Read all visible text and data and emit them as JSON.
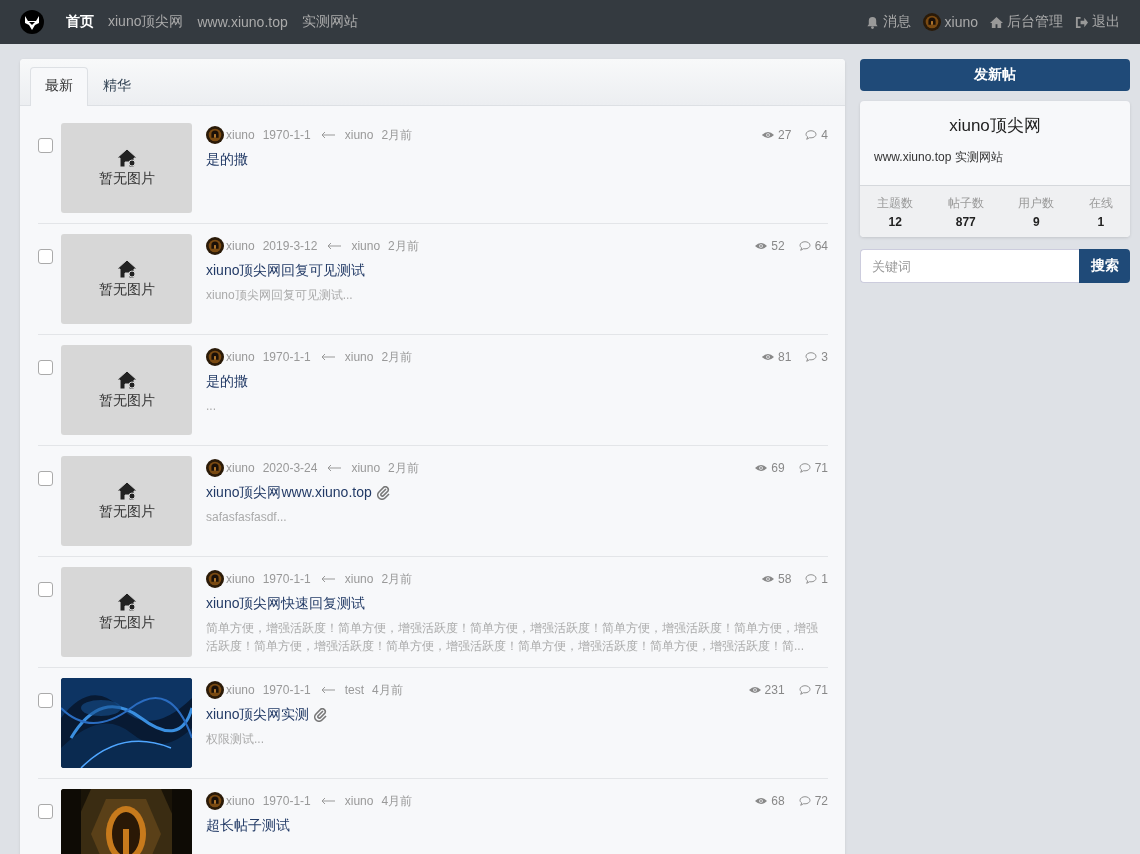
{
  "navbar": {
    "links": [
      {
        "label": "首页",
        "selected": true
      },
      {
        "label": "xiuno顶尖网",
        "selected": false
      },
      {
        "label": "www.xiuno.top",
        "selected": false
      },
      {
        "label": "实测网站",
        "selected": false
      }
    ],
    "right": [
      {
        "kind": "bell",
        "label": "消息"
      },
      {
        "kind": "avatar",
        "label": "xiuno"
      },
      {
        "kind": "home",
        "label": "后台管理"
      },
      {
        "kind": "logout",
        "label": "退出"
      }
    ]
  },
  "tabs": [
    {
      "label": "最新",
      "selected": true
    },
    {
      "label": "精华",
      "selected": false
    }
  ],
  "threads": [
    {
      "checked": false,
      "thumb": {
        "kind": "placeholder",
        "text": "暂无图片"
      },
      "author": "xiuno",
      "date": "1970-1-1",
      "last_user": "xiuno",
      "last_time": "2月前",
      "views": "27",
      "replies": "4",
      "title": "是的撒",
      "attachment": false
    },
    {
      "checked": false,
      "thumb": {
        "kind": "placeholder",
        "text": "暂无图片"
      },
      "author": "xiuno",
      "date": "2019-3-12",
      "last_user": "xiuno",
      "last_time": "2月前",
      "views": "52",
      "replies": "64",
      "title": "xiuno顶尖网回复可见测试",
      "excerpt": "xiuno顶尖网回复可见测试...",
      "attachment": false
    },
    {
      "checked": false,
      "thumb": {
        "kind": "placeholder",
        "text": "暂无图片"
      },
      "author": "xiuno",
      "date": "1970-1-1",
      "last_user": "xiuno",
      "last_time": "2月前",
      "views": "81",
      "replies": "3",
      "title": "是的撒",
      "excerpt": "...",
      "attachment": false
    },
    {
      "checked": false,
      "thumb": {
        "kind": "placeholder",
        "text": "暂无图片"
      },
      "author": "xiuno",
      "date": "2020-3-24",
      "last_user": "xiuno",
      "last_time": "2月前",
      "views": "69",
      "replies": "71",
      "title": "xiuno顶尖网www.xiuno.top",
      "excerpt": "safasfasfasdf...",
      "attachment": true
    },
    {
      "checked": false,
      "thumb": {
        "kind": "placeholder",
        "text": "暂无图片"
      },
      "author": "xiuno",
      "date": "1970-1-1",
      "last_user": "xiuno",
      "last_time": "2月前",
      "views": "58",
      "replies": "1",
      "title": "xiuno顶尖网快速回复测试",
      "excerpt": "简单方便，增强活跃度！简单方便，增强活跃度！简单方便，增强活跃度！简单方便，增强活跃度！简单方便，增强活跃度！简单方便，增强活跃度！简单方便，增强活跃度！简单方便，增强活跃度！简单方便，增强活跃度！简...",
      "attachment": false
    },
    {
      "checked": false,
      "author": "xiuno",
      "date": "1970-1-1",
      "last_user": "test",
      "last_time": "4月前",
      "views": "231",
      "replies": "71",
      "title": "xiuno顶尖网实测",
      "excerpt": "权限测试...",
      "attachment": true
    },
    {
      "checked": false,
      "author": "xiuno",
      "date": "1970-1-1",
      "last_user": "xiuno",
      "last_time": "4月前",
      "views": "68",
      "replies": "72",
      "title": "超长帖子测试",
      "attachment": false
    }
  ],
  "sidebar": {
    "new_post_button": "发新帖",
    "site": {
      "name": "xiuno顶尖网",
      "description": "www.xiuno.top 实测网站",
      "stats": [
        {
          "label": "主题数",
          "value": "12"
        },
        {
          "label": "帖子数",
          "value": "877"
        },
        {
          "label": "用户数",
          "value": "9"
        },
        {
          "label": "在线",
          "value": "1"
        }
      ]
    },
    "search": {
      "placeholder": "关键词",
      "button": "搜索"
    }
  }
}
